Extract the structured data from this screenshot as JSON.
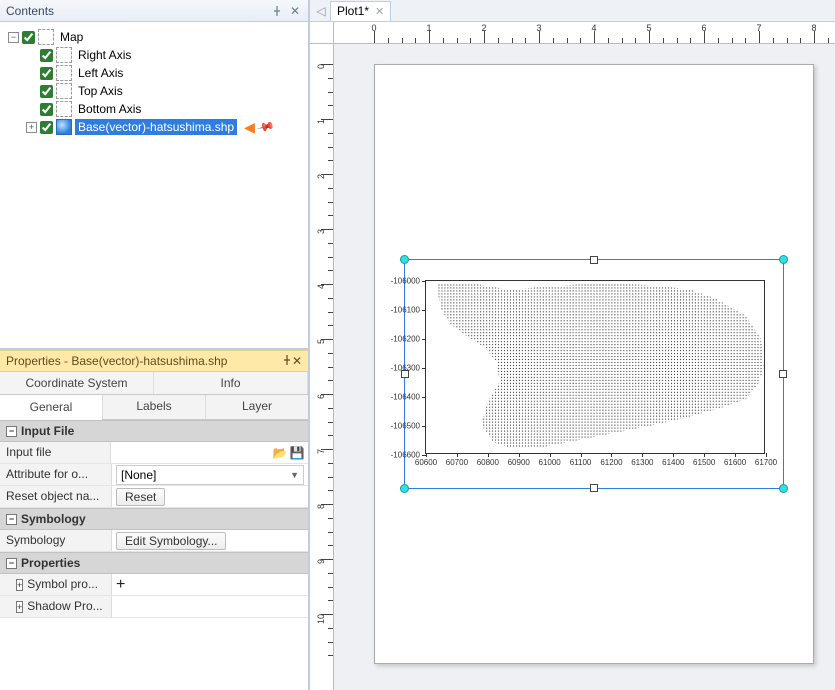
{
  "panels": {
    "contents_title": "Contents",
    "properties_title": "Properties - Base(vector)-hatsushima.shp"
  },
  "tree": {
    "root": "Map",
    "items": [
      "Right Axis",
      "Left Axis",
      "Top Axis",
      "Bottom Axis"
    ],
    "selected": "Base(vector)-hatsushima.shp"
  },
  "tabs": {
    "top": [
      "Coordinate System",
      "Info"
    ],
    "bot": [
      "General",
      "Labels",
      "Layer"
    ],
    "active_bot": "General"
  },
  "props": {
    "sect_input": "Input File",
    "input_file_lbl": "Input file",
    "attr_lbl": "Attribute for o...",
    "attr_val": "[None]",
    "reset_lbl": "Reset object na...",
    "reset_btn": "Reset",
    "sect_symb": "Symbology",
    "symb_lbl": "Symbology",
    "symb_btn": "Edit Symbology...",
    "sect_props": "Properties",
    "symprop_lbl": "Symbol pro...",
    "shadow_lbl": "Shadow Pro..."
  },
  "doc": {
    "tab": "Plot1*"
  },
  "rulers": {
    "h": [
      "0",
      "1",
      "2",
      "3",
      "4",
      "5",
      "6",
      "7",
      "8"
    ],
    "v": [
      "0",
      "1",
      "2",
      "3",
      "4",
      "5",
      "6",
      "7",
      "8",
      "9",
      "10"
    ]
  },
  "chart_data": {
    "type": "scatter",
    "title": "",
    "xlabel": "",
    "ylabel": "",
    "xlim": [
      60600,
      61700
    ],
    "ylim": [
      -106600,
      -106000
    ],
    "xticks": [
      60600,
      60700,
      60800,
      60900,
      61000,
      61100,
      61200,
      61300,
      61400,
      61500,
      61600,
      61700
    ],
    "yticks": [
      -106600,
      -106500,
      -106400,
      -106300,
      -106200,
      -106100,
      -106000
    ],
    "series": [
      {
        "name": "Base(vector)-hatsushima.shp",
        "style": "dense-dot-fill",
        "outline_polygon_xy": [
          [
            60640,
            -106010
          ],
          [
            60760,
            -106010
          ],
          [
            60870,
            -106030
          ],
          [
            60990,
            -106020
          ],
          [
            61120,
            -106010
          ],
          [
            61260,
            -106010
          ],
          [
            61380,
            -106020
          ],
          [
            61460,
            -106030
          ],
          [
            61540,
            -106060
          ],
          [
            61640,
            -106120
          ],
          [
            61690,
            -106200
          ],
          [
            61700,
            -106300
          ],
          [
            61680,
            -106360
          ],
          [
            61640,
            -106410
          ],
          [
            61560,
            -106440
          ],
          [
            61460,
            -106470
          ],
          [
            61340,
            -106500
          ],
          [
            61200,
            -106530
          ],
          [
            61060,
            -106560
          ],
          [
            60960,
            -106580
          ],
          [
            60880,
            -106580
          ],
          [
            60820,
            -106560
          ],
          [
            60780,
            -106500
          ],
          [
            60800,
            -106420
          ],
          [
            60840,
            -106350
          ],
          [
            60830,
            -106280
          ],
          [
            60790,
            -106230
          ],
          [
            60730,
            -106190
          ],
          [
            60680,
            -106150
          ],
          [
            60650,
            -106100
          ],
          [
            60640,
            -106050
          ]
        ]
      }
    ]
  }
}
